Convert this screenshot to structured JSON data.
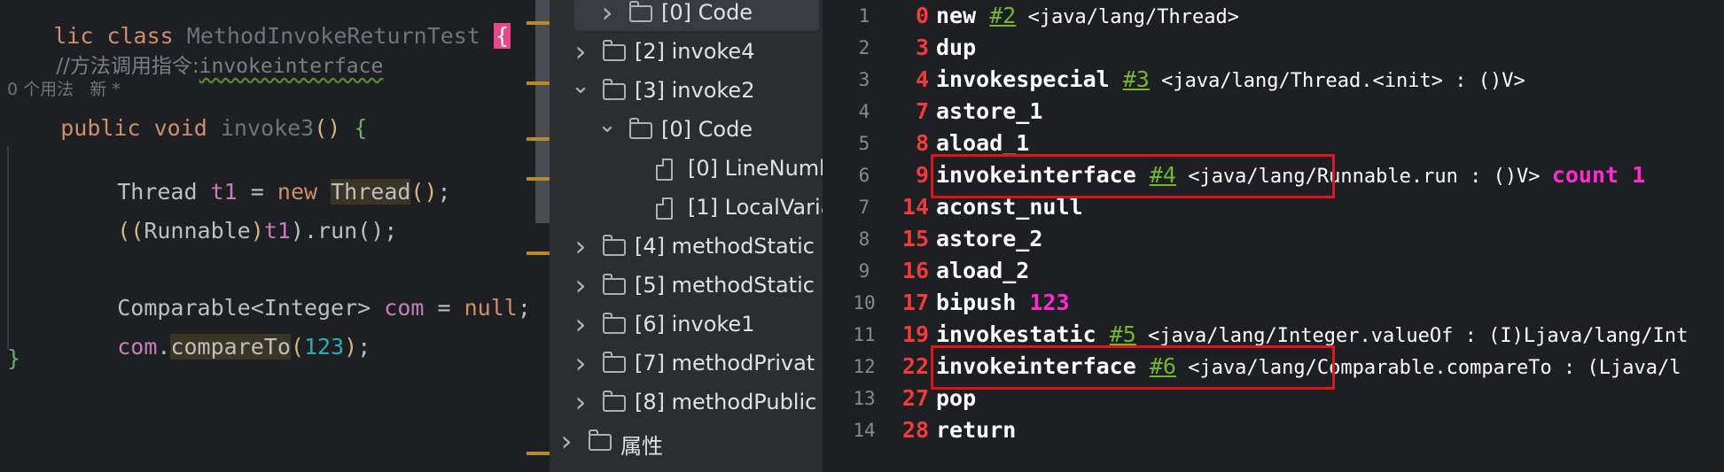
{
  "editor": {
    "class_decl": {
      "kw1": "lic",
      "kw2": "class",
      "name": "MethodInvokeReturnTest",
      "brace": "{"
    },
    "comment": "//方法调用指令:",
    "comment_link": "invokeinterface",
    "hint": "0 个用法   新 *",
    "method_decl": {
      "kw1": "public",
      "kw2": "void",
      "name": "invoke3",
      "parens": "()",
      "brace": "{"
    },
    "line1": {
      "type": "Thread",
      "var": "t1",
      "eq": "=",
      "new": "new",
      "ctor": "Thread",
      "parens": "()",
      "semi": ";"
    },
    "line2": {
      "p1": "((",
      "type": "Runnable",
      "p2": ")",
      "var": "t1",
      "p3": ").",
      "call": "run",
      "parens": "()",
      "semi": ";"
    },
    "line3": {
      "type": "Comparable",
      "generic": "<Integer>",
      "var": "com",
      "eq": "=",
      "val": "null",
      "semi": ";"
    },
    "line4": {
      "var": "com",
      "dot": ".",
      "call": "compareTo",
      "p1": "(",
      "arg": "123",
      "p2": ")",
      "semi": ";"
    },
    "close_brace": "}"
  },
  "tree": {
    "items": [
      {
        "label": "[0] Code",
        "type": "folder",
        "chevron": "right",
        "indent": 2,
        "selected": true
      },
      {
        "label": "[2] invoke4",
        "type": "folder",
        "chevron": "right",
        "indent": 1
      },
      {
        "label": "[3] invoke2",
        "type": "folder",
        "chevron": "down",
        "indent": 1
      },
      {
        "label": "[0] Code",
        "type": "folder",
        "chevron": "down",
        "indent": 2
      },
      {
        "label": "[0] LineNumb",
        "type": "file",
        "indent": 3
      },
      {
        "label": "[1] LocalVaria",
        "type": "file",
        "indent": 3
      },
      {
        "label": "[4] methodStatic",
        "type": "folder",
        "chevron": "right",
        "indent": 1
      },
      {
        "label": "[5] methodStatic",
        "type": "folder",
        "chevron": "right",
        "indent": 1
      },
      {
        "label": "[6] invoke1",
        "type": "folder",
        "chevron": "right",
        "indent": 1
      },
      {
        "label": "[7] methodPrivat",
        "type": "folder",
        "chevron": "right",
        "indent": 1
      },
      {
        "label": "[8] methodPublic",
        "type": "folder",
        "chevron": "right",
        "indent": 1
      },
      {
        "label": "属性",
        "type": "folder",
        "chevron": "right",
        "indent": 0
      }
    ]
  },
  "bytecode": {
    "lines": [
      {
        "ln": "1",
        "off": "0",
        "op": "new",
        "ref": "#2",
        "sym": " <java/lang/Thread>"
      },
      {
        "ln": "2",
        "off": "3",
        "op": "dup"
      },
      {
        "ln": "3",
        "off": "4",
        "op": "invokespecial",
        "ref": "#3",
        "sym": " <java/lang/Thread.<init> : ()V>"
      },
      {
        "ln": "4",
        "off": "7",
        "op": "astore_1"
      },
      {
        "ln": "5",
        "off": "8",
        "op": "aload_1"
      },
      {
        "ln": "6",
        "off": "9",
        "op": "invokeinterface",
        "ref": "#4",
        "sym": " <java/lang/Runnable.run : ()V> ",
        "extra": "count 1"
      },
      {
        "ln": "7",
        "off": "14",
        "op": "aconst_null"
      },
      {
        "ln": "8",
        "off": "15",
        "op": "astore_2"
      },
      {
        "ln": "9",
        "off": "16",
        "op": "aload_2"
      },
      {
        "ln": "10",
        "off": "17",
        "op": "bipush",
        "extra": "123"
      },
      {
        "ln": "11",
        "off": "19",
        "op": "invokestatic",
        "ref": "#5",
        "sym": " <java/lang/Integer.valueOf : (I)Ljava/lang/Int"
      },
      {
        "ln": "12",
        "off": "22",
        "op": "invokeinterface",
        "ref": "#6",
        "sym": " <java/lang/Comparable.compareTo : (Ljava/l"
      },
      {
        "ln": "13",
        "off": "27",
        "op": "pop"
      },
      {
        "ln": "14",
        "off": "28",
        "op": "return"
      }
    ]
  },
  "colors": {
    "highlight_box": "#e1141c",
    "bytecode_offset": "#f03c3c",
    "reference": "#74b72f",
    "emphasis": "#ff2ad4"
  }
}
